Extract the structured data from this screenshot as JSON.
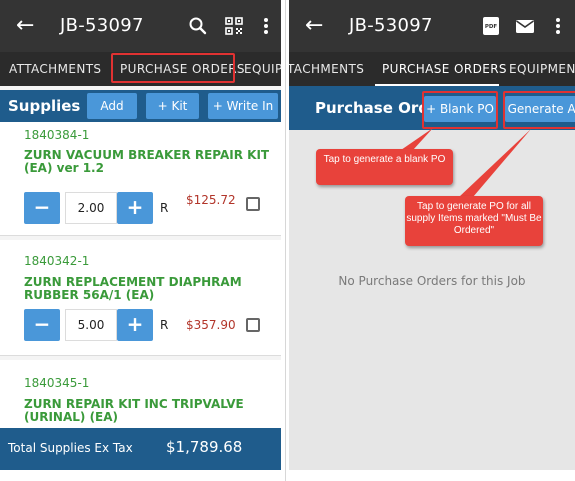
{
  "left": {
    "appbar": {
      "title": "JB-53097",
      "back_glyph": "←"
    },
    "tabs": [
      "ATTACHMENTS",
      "PURCHASE ORDERS",
      "EQUIP"
    ],
    "supplies": {
      "label": "Supplies",
      "buttons": [
        "Add",
        "+ Kit",
        "+ Write In"
      ]
    },
    "items": [
      {
        "code": "1840384-1",
        "desc": "ZURN VACUUM BREAKER REPAIR KIT (EA) ver 1.2",
        "qty": "2.00",
        "r": "R",
        "price": "$125.72"
      },
      {
        "code": "1840342-1",
        "desc": "ZURN REPLACEMENT DIAPHRAM RUBBER 56A/1 (EA)",
        "qty": "5.00",
        "r": "R",
        "price": "$357.90"
      },
      {
        "code": "1840345-1",
        "desc": "ZURN REPAIR KIT INC TRIPVALVE (URINAL) (EA)"
      }
    ],
    "stepper": {
      "minus": "−",
      "plus": "+"
    },
    "total": {
      "label": "Total Supplies Ex Tax",
      "value": "$1,789.68"
    }
  },
  "right": {
    "appbar": {
      "title": "JB-53097",
      "back_glyph": "←"
    },
    "tabs": [
      "TACHMENTS",
      "PURCHASE ORDERS",
      "EQUIPMENT"
    ],
    "po": {
      "label": "Purchase Orders",
      "blank_po": "+ Blank PO",
      "generate_all": "Generate All"
    },
    "callouts": {
      "blank": "Tap to generate a blank PO",
      "generate": "Tap to generate PO for all supply Items marked \"Must Be Ordered\""
    },
    "empty": "No Purchase Orders for this Job"
  },
  "colors": {
    "appbar": "#343434",
    "tabbar": "#2b2b2b",
    "header_blue": "#1f5c8c",
    "button_blue": "#4a97d9",
    "highlight": "#e03232",
    "callout": "#e8423b",
    "item_text": "#3a9a3a",
    "price": "#b2352a"
  },
  "icons": [
    "back-arrow-icon",
    "search-icon",
    "qr-code-icon",
    "more-vert-icon",
    "pdf-icon",
    "mail-icon"
  ]
}
